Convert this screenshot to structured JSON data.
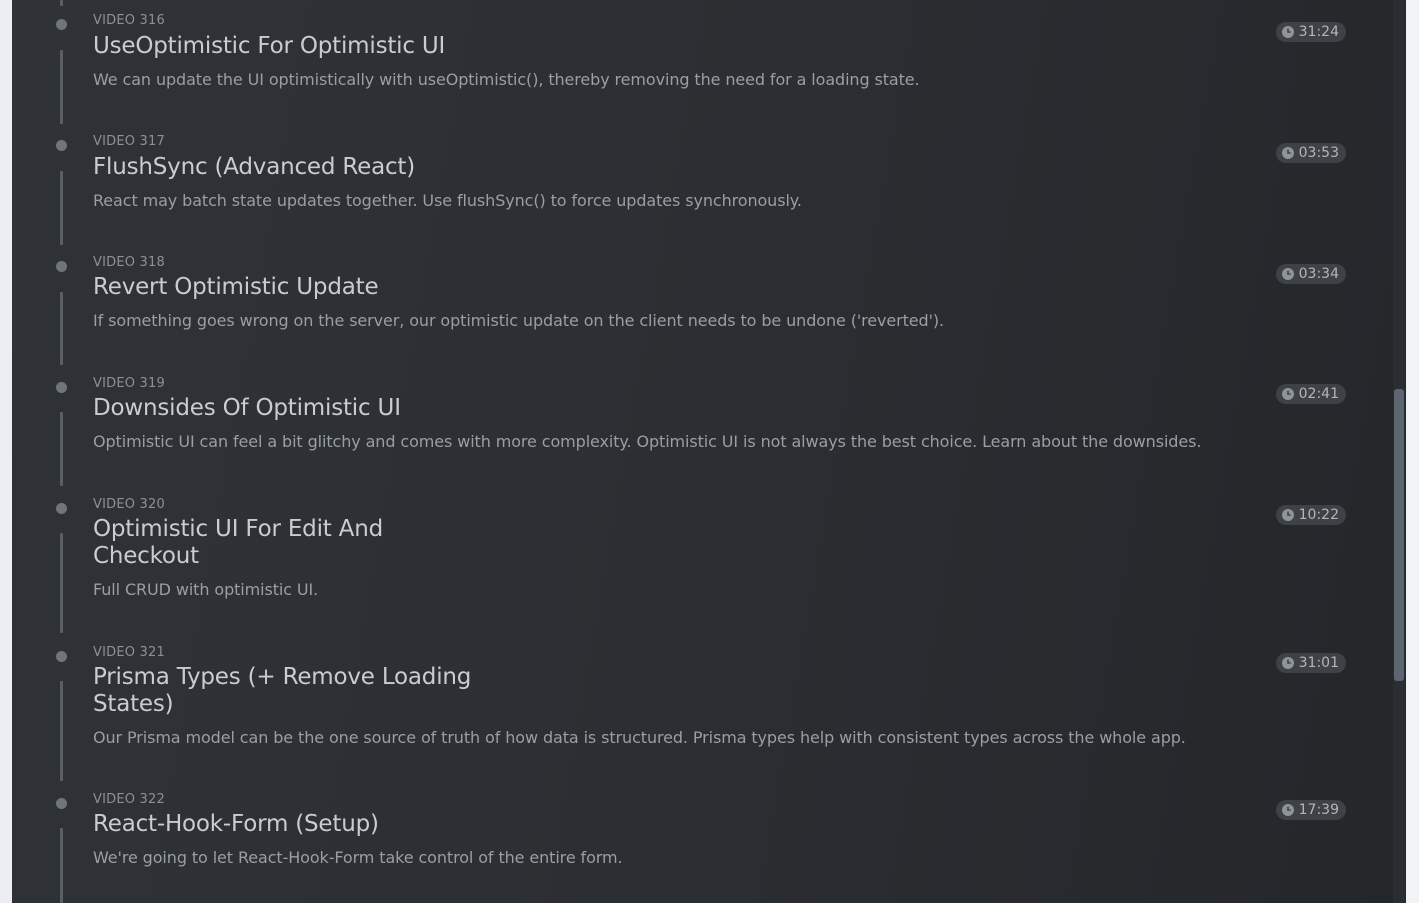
{
  "videos": [
    {
      "label": "VIDEO 316",
      "title": "UseOptimistic For Optimistic UI",
      "description": "We can update the UI optimistically with useOptimistic(), thereby removing the need for a loading state.",
      "duration": "31:24"
    },
    {
      "label": "VIDEO 317",
      "title": "FlushSync (Advanced React)",
      "description": "React may batch state updates together. Use flushSync() to force updates synchronously.",
      "duration": "03:53"
    },
    {
      "label": "VIDEO 318",
      "title": "Revert Optimistic Update",
      "description": "If something goes wrong on the server, our optimistic update on the client needs to be undone ('reverted').",
      "duration": "03:34"
    },
    {
      "label": "VIDEO 319",
      "title": "Downsides Of Optimistic UI",
      "description": "Optimistic UI can feel a bit glitchy and comes with more complexity. Optimistic UI is not always the best choice. Learn about the downsides.",
      "duration": "02:41"
    },
    {
      "label": "VIDEO 320",
      "title": "Optimistic UI For Edit And Checkout",
      "description": "Full CRUD with optimistic UI.",
      "duration": "10:22"
    },
    {
      "label": "VIDEO 321",
      "title": "Prisma Types (+ Remove Loading States)",
      "description": "Our Prisma model can be the one source of truth of how data is structured. Prisma types help with consistent types across the whole app.",
      "duration": "31:01"
    },
    {
      "label": "VIDEO 322",
      "title": "React-Hook-Form (Setup)",
      "description": "We're going to let React-Hook-Form take control of the entire form.",
      "duration": "17:39"
    }
  ],
  "icons": {
    "timeline_dot": "timeline-dot-icon",
    "duration": "clock-icon"
  },
  "colors": {
    "panel_background": "#2b2e32",
    "title_text": "#c9ccd1",
    "description_text": "#9a9ea5",
    "badge_background": "#3e4247",
    "scrollbar_thumb": "#5d6670"
  }
}
